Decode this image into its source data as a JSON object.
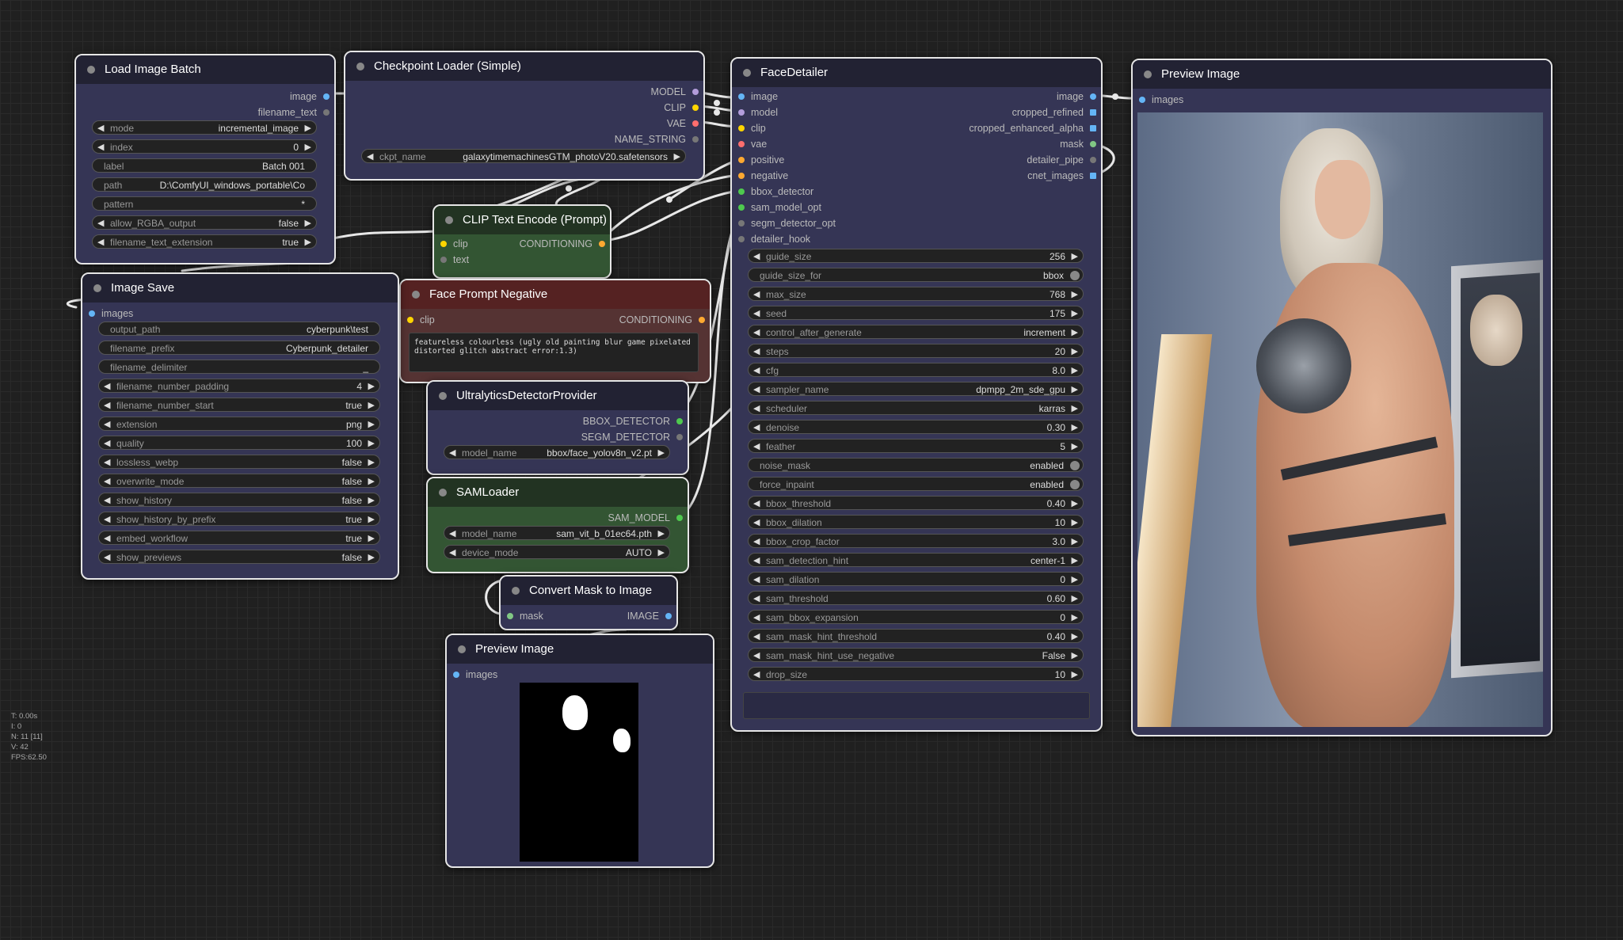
{
  "colors": {
    "image": "#64b5f6",
    "model": "#b39ddb",
    "clip": "#ffd500",
    "vae": "#ff6e6e",
    "conditioning": "#ffa931",
    "detector": "#4ec94e",
    "mask": "#81c784",
    "grey": "#777777"
  },
  "nodes": {
    "load_image_batch": {
      "title": "Load Image Batch",
      "outputs": [
        "image",
        "filename_text"
      ],
      "widgets": [
        {
          "name": "mode",
          "value": "incremental_image"
        },
        {
          "name": "index",
          "value": "0"
        },
        {
          "name": "label",
          "value": "Batch 001"
        },
        {
          "name": "path",
          "value": "D:\\ComfyUI_windows_portable\\Co"
        },
        {
          "name": "pattern",
          "value": "*"
        },
        {
          "name": "allow_RGBA_output",
          "value": "false"
        },
        {
          "name": "filename_text_extension",
          "value": "true"
        }
      ]
    },
    "checkpoint_loader": {
      "title": "Checkpoint Loader (Simple)",
      "outputs": [
        "MODEL",
        "CLIP",
        "VAE",
        "NAME_STRING"
      ],
      "widgets": [
        {
          "name": "ckpt_name",
          "value": "galaxytimemachinesGTM_photoV20.safetensors"
        }
      ]
    },
    "clip_text_encode": {
      "title": "CLIP Text Encode (Prompt)",
      "inputs": [
        "clip",
        "text"
      ],
      "outputs": [
        "CONDITIONING"
      ]
    },
    "face_prompt_negative": {
      "title": "Face Prompt Negative",
      "inputs": [
        "clip"
      ],
      "outputs": [
        "CONDITIONING"
      ],
      "text": "featureless colourless (ugly old painting blur game pixelated distorted glitch abstract error:1.3)"
    },
    "image_save": {
      "title": "Image Save",
      "inputs": [
        "images"
      ],
      "widgets": [
        {
          "name": "output_path",
          "value": "cyberpunk\\test"
        },
        {
          "name": "filename_prefix",
          "value": "Cyberpunk_detailer"
        },
        {
          "name": "filename_delimiter",
          "value": "_"
        },
        {
          "name": "filename_number_padding",
          "value": "4"
        },
        {
          "name": "filename_number_start",
          "value": "true"
        },
        {
          "name": "extension",
          "value": "png"
        },
        {
          "name": "quality",
          "value": "100"
        },
        {
          "name": "lossless_webp",
          "value": "false"
        },
        {
          "name": "overwrite_mode",
          "value": "false"
        },
        {
          "name": "show_history",
          "value": "false"
        },
        {
          "name": "show_history_by_prefix",
          "value": "true"
        },
        {
          "name": "embed_workflow",
          "value": "true"
        },
        {
          "name": "show_previews",
          "value": "false"
        }
      ]
    },
    "ultralytics": {
      "title": "UltralyticsDetectorProvider",
      "outputs": [
        "BBOX_DETECTOR",
        "SEGM_DETECTOR"
      ],
      "widgets": [
        {
          "name": "model_name",
          "value": "bbox/face_yolov8n_v2.pt"
        }
      ]
    },
    "samloader": {
      "title": "SAMLoader",
      "outputs": [
        "SAM_MODEL"
      ],
      "widgets": [
        {
          "name": "model_name",
          "value": "sam_vit_b_01ec64.pth"
        },
        {
          "name": "device_mode",
          "value": "AUTO"
        }
      ]
    },
    "convert_mask": {
      "title": "Convert Mask to Image",
      "inputs": [
        "mask"
      ],
      "outputs": [
        "IMAGE"
      ]
    },
    "preview_mask": {
      "title": "Preview Image",
      "inputs": [
        "images"
      ]
    },
    "face_detailer": {
      "title": "FaceDetailer",
      "inputs": [
        "image",
        "model",
        "clip",
        "vae",
        "positive",
        "negative",
        "bbox_detector",
        "sam_model_opt",
        "segm_detector_opt",
        "detailer_hook"
      ],
      "outputs": [
        "image",
        "cropped_refined",
        "cropped_enhanced_alpha",
        "mask",
        "detailer_pipe",
        "cnet_images"
      ],
      "widgets": [
        {
          "name": "guide_size",
          "value": "256"
        },
        {
          "name": "guide_size_for",
          "value": "bbox",
          "toggle": true
        },
        {
          "name": "max_size",
          "value": "768"
        },
        {
          "name": "seed",
          "value": "175"
        },
        {
          "name": "control_after_generate",
          "value": "increment"
        },
        {
          "name": "steps",
          "value": "20"
        },
        {
          "name": "cfg",
          "value": "8.0"
        },
        {
          "name": "sampler_name",
          "value": "dpmpp_2m_sde_gpu"
        },
        {
          "name": "scheduler",
          "value": "karras"
        },
        {
          "name": "denoise",
          "value": "0.30"
        },
        {
          "name": "feather",
          "value": "5"
        },
        {
          "name": "noise_mask",
          "value": "enabled",
          "toggle": true
        },
        {
          "name": "force_inpaint",
          "value": "enabled",
          "toggle": true
        },
        {
          "name": "bbox_threshold",
          "value": "0.40"
        },
        {
          "name": "bbox_dilation",
          "value": "10"
        },
        {
          "name": "bbox_crop_factor",
          "value": "3.0"
        },
        {
          "name": "sam_detection_hint",
          "value": "center-1"
        },
        {
          "name": "sam_dilation",
          "value": "0"
        },
        {
          "name": "sam_threshold",
          "value": "0.60"
        },
        {
          "name": "sam_bbox_expansion",
          "value": "0"
        },
        {
          "name": "sam_mask_hint_threshold",
          "value": "0.40"
        },
        {
          "name": "sam_mask_hint_use_negative",
          "value": "False"
        },
        {
          "name": "drop_size",
          "value": "10"
        }
      ]
    },
    "preview_image": {
      "title": "Preview Image",
      "inputs": [
        "images"
      ]
    }
  },
  "stats": [
    "T: 0.00s",
    "I: 0",
    "N: 11 [11]",
    "V: 42",
    "FPS:62.50"
  ]
}
